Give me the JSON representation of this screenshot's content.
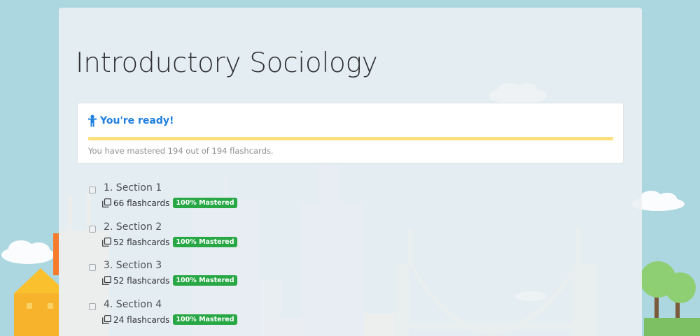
{
  "page": {
    "title": "Introductory Sociology"
  },
  "ready_card": {
    "heading": "You're ready!",
    "icon": "child-icon",
    "mastered_text": "You have mastered 194 out of 194 flashcards.",
    "mastered_count": 194,
    "total_count": 194,
    "progress_fraction": 1.0,
    "progress_color": "#ffe07e",
    "heading_color": "#1f7fe0"
  },
  "sections": [
    {
      "title": "1. Section 1",
      "count": "66 flashcards",
      "badge": "100% Mastered"
    },
    {
      "title": "2. Section 2",
      "count": "52 flashcards",
      "badge": "100% Mastered"
    },
    {
      "title": "3. Section 3",
      "count": "52 flashcards",
      "badge": "100% Mastered"
    },
    {
      "title": "4. Section 4",
      "count": "24 flashcards",
      "badge": "100% Mastered"
    }
  ],
  "colors": {
    "background": "#acd7e1",
    "badge": "#28a745"
  }
}
